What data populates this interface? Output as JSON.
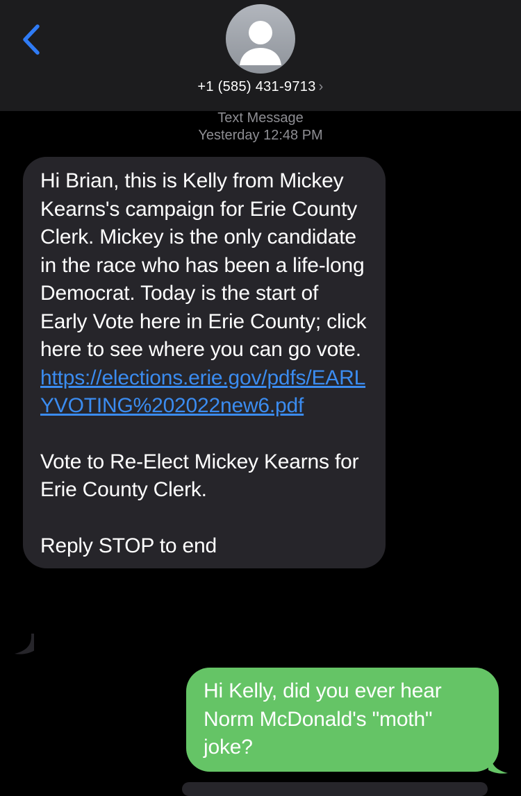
{
  "header": {
    "contact_number": "+1 (585) 431-9713",
    "chevron": "›",
    "back_icon": "chevron-left-icon",
    "avatar_icon": "person-silhouette-icon"
  },
  "timestamp": {
    "service": "Text Message",
    "time": "Yesterday 12:48 PM"
  },
  "messages": [
    {
      "direction": "incoming",
      "paragraph1": "Hi Brian, this is Kelly from Mickey Kearns's campaign for Erie County Clerk. Mickey is the only candidate in the race who has been a life-long Democrat. Today is the start of Early Vote here in Erie County; click here to see where you can go vote.",
      "link": "https://elections.erie.gov/pdfs/EARLYVOTING%202022new6.pdf",
      "paragraph2": "Vote to Re-Elect Mickey Kearns for Erie County Clerk.",
      "paragraph3": "Reply STOP to end"
    },
    {
      "direction": "outgoing",
      "text": "Hi Kelly, did you ever hear Norm McDonald's \"moth\" joke?"
    }
  ],
  "colors": {
    "header_bg": "#1c1c1e",
    "incoming_bubble": "#26252a",
    "outgoing_bubble": "#65c466",
    "link": "#3b8cf0",
    "accent": "#2f7bf5"
  }
}
